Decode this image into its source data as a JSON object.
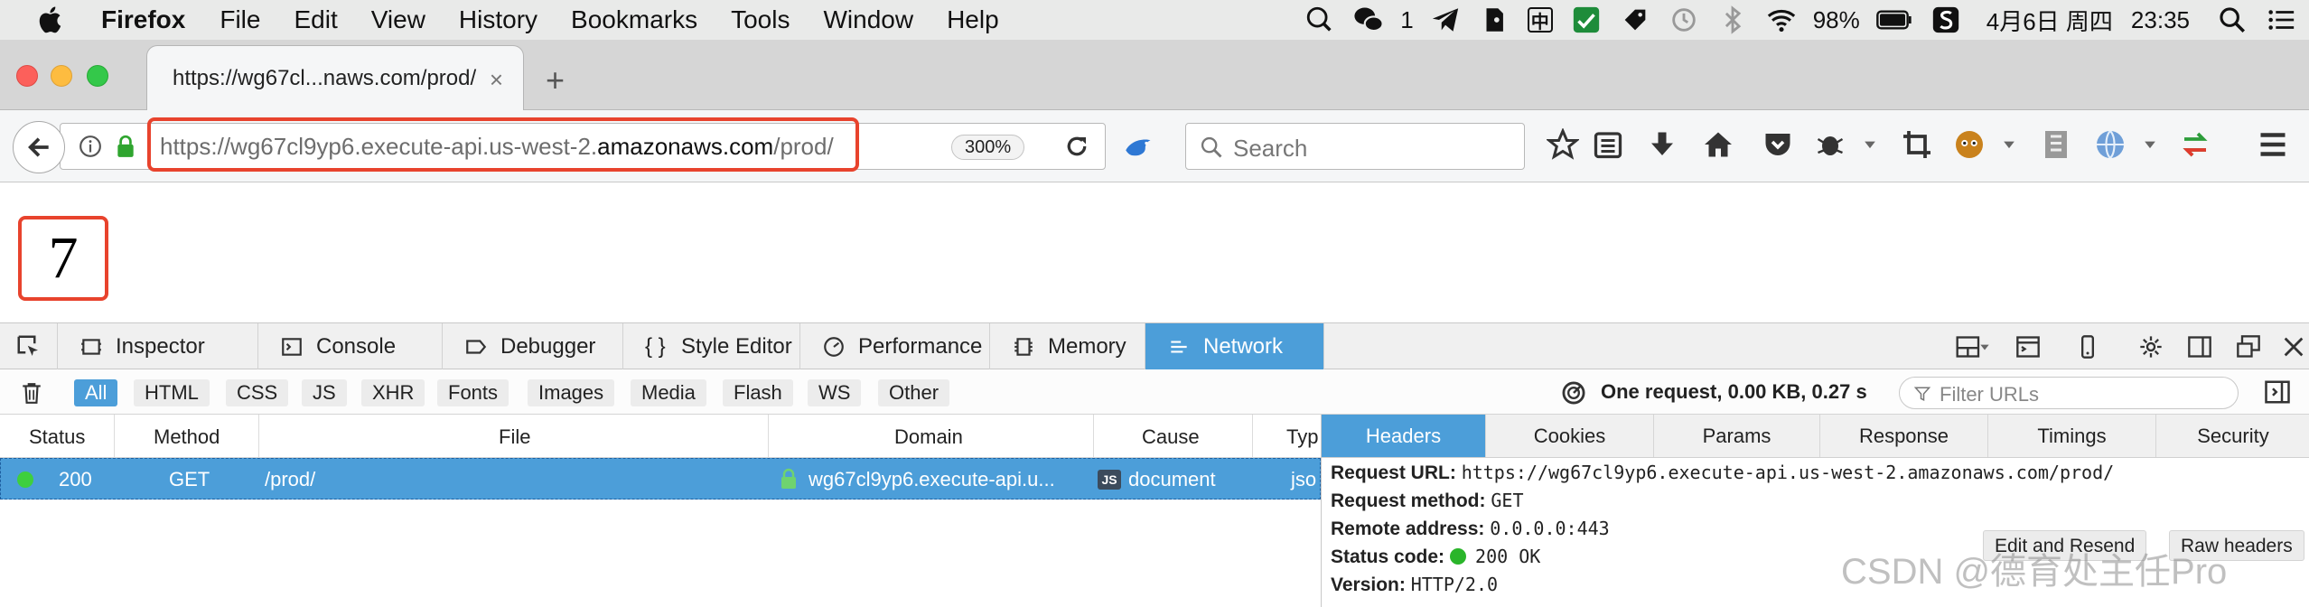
{
  "menubar": {
    "app_name": "Firefox",
    "items": [
      "File",
      "Edit",
      "View",
      "History",
      "Bookmarks",
      "Tools",
      "Window",
      "Help"
    ],
    "wechat_count": "1",
    "ime_label": "中",
    "battery": "98%",
    "date": "4月6日 周四",
    "time": "23:35"
  },
  "tab": {
    "title": "https://wg67cl...naws.com/prod/",
    "close_glyph": "×",
    "new_tab_glyph": "+"
  },
  "navbar": {
    "url_prefix": "https://wg67cl9yp6.execute-api.us-west-2.",
    "url_host": "amazonaws.com",
    "url_path": "/prod/",
    "zoom": "300%",
    "search_placeholder": "Search"
  },
  "page": {
    "result": "7"
  },
  "devtools": {
    "tabs": [
      {
        "label": "Inspector"
      },
      {
        "label": "Console"
      },
      {
        "label": "Debugger"
      },
      {
        "label": "Style Editor"
      },
      {
        "label": "Performance"
      },
      {
        "label": "Memory"
      },
      {
        "label": "Network",
        "active": true
      }
    ],
    "filters": [
      "All",
      "HTML",
      "CSS",
      "JS",
      "XHR",
      "Fonts",
      "Images",
      "Media",
      "Flash",
      "WS",
      "Other"
    ],
    "active_filter": "All",
    "summary": "One request, 0.00 KB, 0.27 s",
    "filter_placeholder": "Filter URLs"
  },
  "requests": {
    "columns": [
      "Status",
      "Method",
      "File",
      "Domain",
      "Cause",
      "Typ"
    ],
    "rows": [
      {
        "status": "200",
        "method": "GET",
        "file": "/prod/",
        "domain": "wg67cl9yp6.execute-api.u...",
        "cause_badge": "JS",
        "cause": "document",
        "type": "jso"
      }
    ]
  },
  "details": {
    "tabs": [
      "Headers",
      "Cookies",
      "Params",
      "Response",
      "Timings",
      "Security"
    ],
    "active_tab": "Headers",
    "request_url_label": "Request URL:",
    "request_url": "https://wg67cl9yp6.execute-api.us-west-2.amazonaws.com/prod/",
    "method_label": "Request method:",
    "method": "GET",
    "remote_label": "Remote address:",
    "remote": "0.0.0.0:443",
    "status_label": "Status code:",
    "status": "200 OK",
    "version_label": "Version:",
    "version": "HTTP/2.0",
    "edit_resend": "Edit and Resend",
    "raw_headers": "Raw headers"
  },
  "watermark": "CSDN @德育处主任Pro",
  "colors": {
    "accent": "#4c9ed9",
    "highlight": "#e8432d",
    "status_ok": "#2ab52a"
  }
}
